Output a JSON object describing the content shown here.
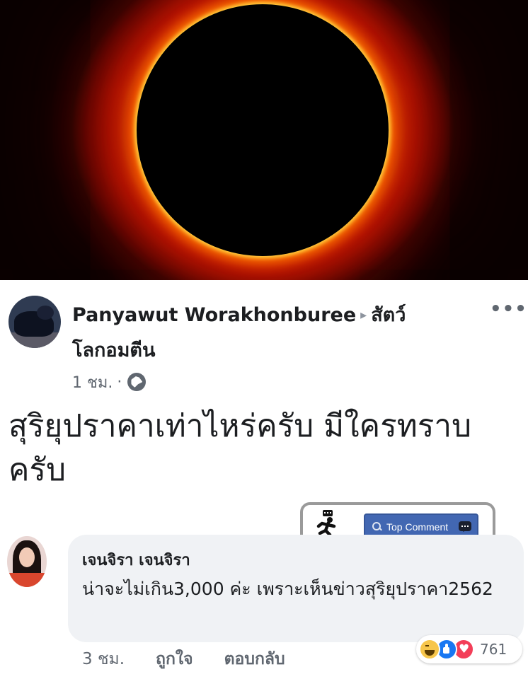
{
  "post": {
    "author": "Panyawut Worakhonburee",
    "arrow": "▸",
    "group": "สัตว์",
    "group_line2": "โลกอมตีน",
    "time": "1 ชม.",
    "separator": "·",
    "text": "สุริยุปราคาเท่าไหร่ครับ มีใครทราบครับ",
    "more": "•••"
  },
  "badge": {
    "label": "Top Comment"
  },
  "comment": {
    "author": "เจนจิรา เจนจิรา",
    "text": "น่าจะไม่เกิน3,000 ค่ะ เพราะเห็นข่าวสุริยุปราคา2562",
    "time": "3 ชม.",
    "like_label": "ถูกใจ",
    "reply_label": "ตอบกลับ",
    "reaction_count": "761",
    "reactions": [
      "haha-icon",
      "like-icon",
      "love-icon"
    ]
  },
  "colors": {
    "pill": "#4267b2",
    "bubble_bg": "#f0f2f5",
    "meta_text": "#606770"
  }
}
